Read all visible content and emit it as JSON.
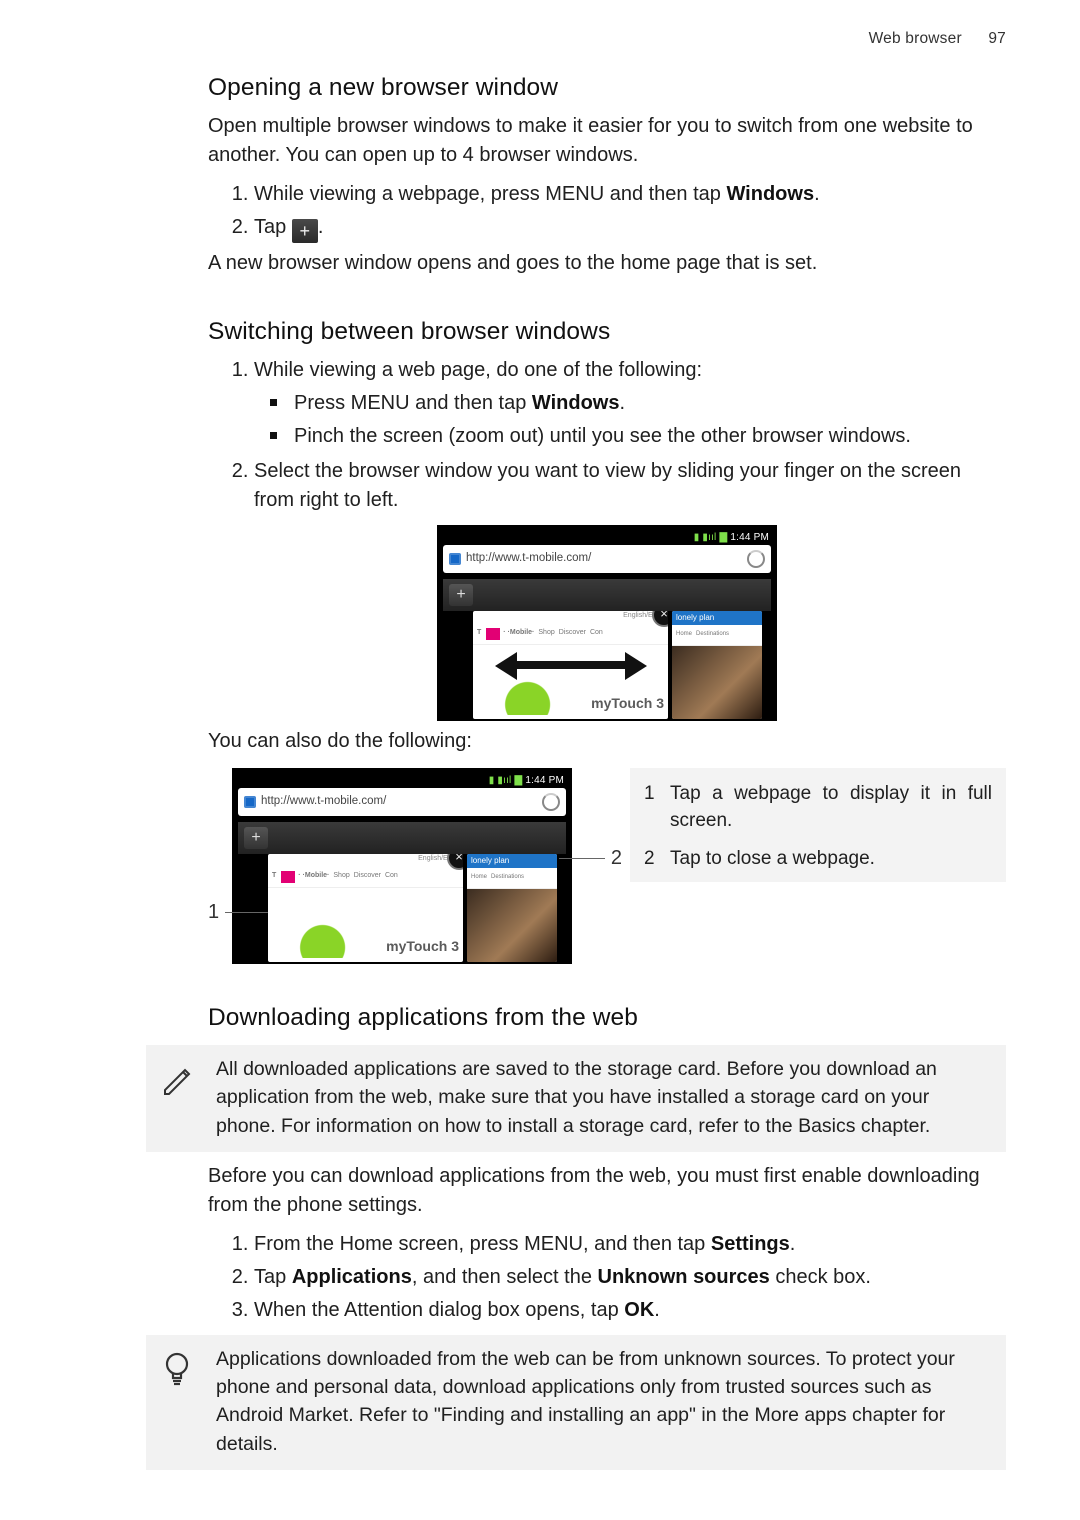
{
  "header": {
    "section": "Web browser",
    "page": "97"
  },
  "s1": {
    "title": "Opening a new browser window",
    "intro": "Open multiple browser windows to make it easier for you to switch from one website to another. You can open up to 4 browser windows.",
    "step1_a": "While viewing a webpage, press MENU and then tap ",
    "step1_b_bold": "Windows",
    "step1_c": ".",
    "step2_a": "Tap ",
    "step2_c": ".",
    "outro": "A new browser window opens and goes to the home page that is set."
  },
  "s2": {
    "title": "Switching between browser windows",
    "step1": "While viewing a web page, do one of the following:",
    "b1_a": "Press MENU and then tap ",
    "b1_b_bold": "Windows",
    "b1_c": ".",
    "b2": "Pinch the screen (zoom out) until you see the other browser windows.",
    "step2": "Select the browser window you want to view by sliding your finger on the screen from right to left.",
    "also": "You can also do the following:",
    "legend": {
      "n1": "1",
      "t1": "Tap a webpage to display it in full screen.",
      "n2": "2",
      "t2": "Tap to close a webpage."
    },
    "callouts": {
      "c1": "1",
      "c2": "2"
    }
  },
  "phone": {
    "time": "1:44 PM",
    "status_icons": "▮ ▮ııl ▇",
    "url": "http://www.t-mobile.com/",
    "lang": "English/Espa",
    "brand": "· ·Mobile·",
    "nav_shop": "Shop",
    "nav_discover": "Discover",
    "nav_con": "Con",
    "hero": "myTouch 3",
    "side_title": "lonely plan",
    "side_nav1": "Home",
    "side_nav2": "Destinations"
  },
  "s3": {
    "title": "Downloading applications from the web",
    "note1": "All downloaded applications are saved to the storage card. Before you download an application from the web, make sure that you have installed a storage card on your phone. For information on how to install a storage card, refer to the Basics chapter.",
    "intro": "Before you can download applications from the web, you must first enable downloading from the phone settings.",
    "st1_a": "From the Home screen, press MENU, and then tap ",
    "st1_b_bold": "Settings",
    "st1_c": ".",
    "st2_a": "Tap ",
    "st2_b_bold": "Applications",
    "st2_c": ", and then select the ",
    "st2_d_bold": "Unknown sources",
    "st2_e": " check box.",
    "st3_a": "When the Attention dialog box opens, tap ",
    "st3_b_bold": "OK",
    "st3_c": ".",
    "note2": "Applications downloaded from the web can be from unknown sources. To protect your phone and personal data, download applications only from trusted sources such as Android Market. Refer to \"Finding and installing an app\" in the More apps chapter for details."
  }
}
